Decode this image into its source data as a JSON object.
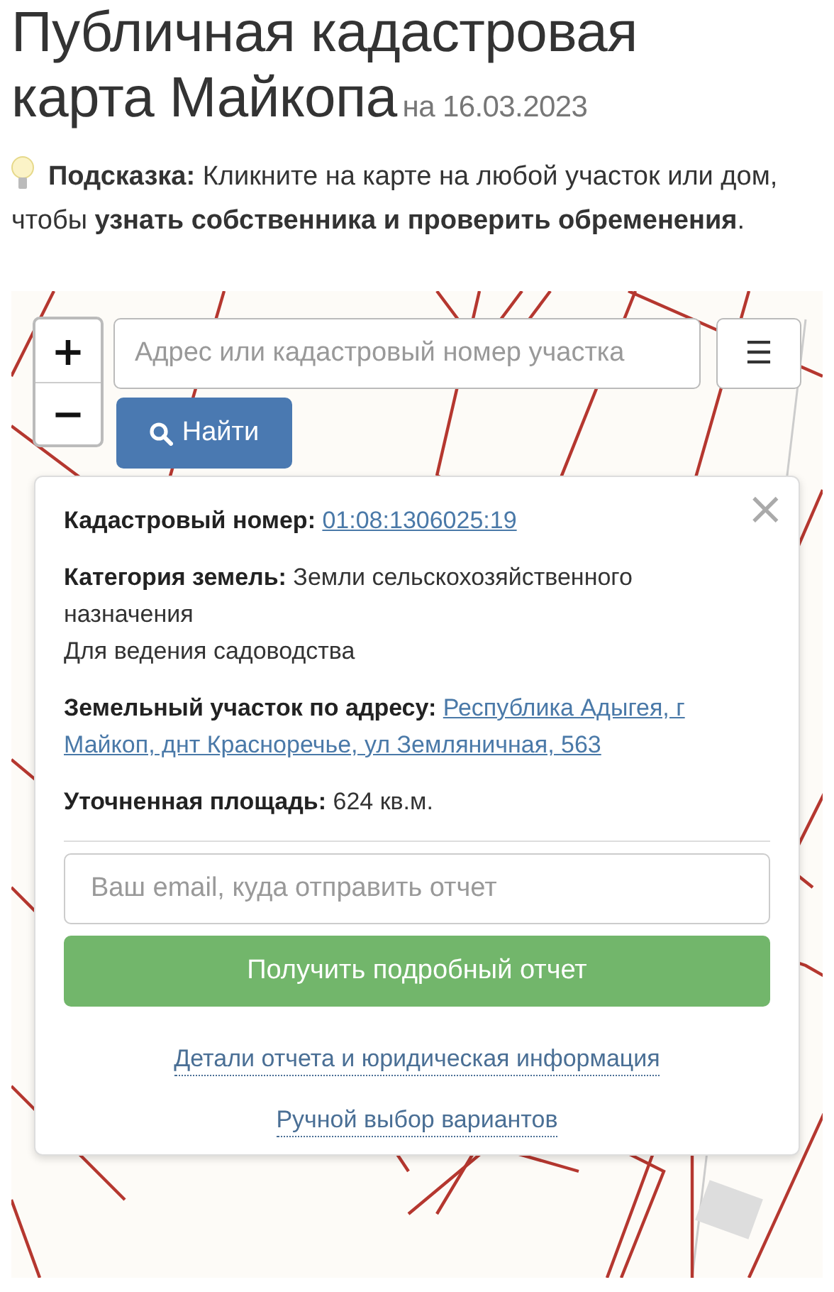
{
  "title": "Публичная кадастровая карта Майкопа",
  "date": "на 16.03.2023",
  "hint": "**Подсказка:** Кликните на карте на любой участок или дом, чтобы **узнать собственника и проверить обременения**.",
  "map": {
    "zoom_in": "+",
    "zoom_out": "−",
    "search": {
      "placeholder": "Адрес или кадастровый номер участка"
    },
    "menu_button": "☰",
    "find_button": "Найти",
    "popup": {
      "close": "×",
      "fields": [
        {
          "label": "Кадастровый номер:",
          "value": "01:08:1306025:19",
          "kind": "link"
        },
        {
          "label": "Категория земель:",
          "value": "Земли сельскохозяйственного назначения",
          "note": "Для ведения садоводства",
          "kind": "text"
        },
        {
          "label": "Земельный участок по адресу:",
          "value": "Республика Адыгея, г Майкоп, днт Красноречье, ул Земляничная, 563",
          "kind": "link"
        },
        {
          "label": "Уточненная площадь:",
          "value": "624 кв.м.",
          "kind": "text"
        }
      ],
      "email": {
        "placeholder": "Ваш email, куда отправить отчет"
      },
      "report_button": "Получить подробный отчет",
      "links": [
        "Детали отчета и юридическая информация",
        "Ручной выбор вариантов"
      ]
    }
  }
}
